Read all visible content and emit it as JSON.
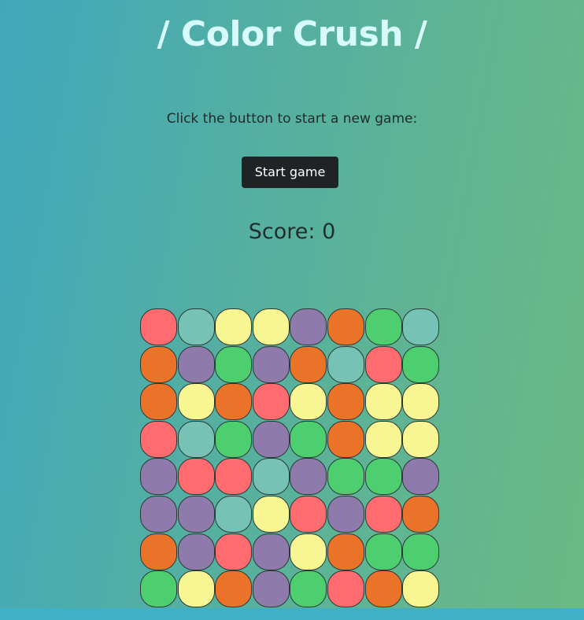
{
  "header": {
    "title": "/ Color Crush /"
  },
  "intro": {
    "prompt": "Click the button to start a new game:",
    "start_label": "Start game"
  },
  "score": {
    "label": "Score:",
    "value": "0"
  },
  "colors": {
    "red": "#ff6b6f",
    "teal": "#76c2b5",
    "yellow": "#f8f593",
    "purple": "#8e7aab",
    "orange": "#ea7229",
    "green": "#4dcf70"
  },
  "board": {
    "rows": 8,
    "cols": 8,
    "grid": [
      [
        "red",
        "teal",
        "yellow",
        "yellow",
        "purple",
        "orange",
        "green",
        "teal"
      ],
      [
        "orange",
        "purple",
        "green",
        "purple",
        "orange",
        "teal",
        "red",
        "green"
      ],
      [
        "orange",
        "yellow",
        "orange",
        "red",
        "yellow",
        "orange",
        "yellow",
        "yellow"
      ],
      [
        "red",
        "teal",
        "green",
        "purple",
        "green",
        "orange",
        "yellow",
        "yellow"
      ],
      [
        "purple",
        "red",
        "red",
        "teal",
        "purple",
        "green",
        "green",
        "purple"
      ],
      [
        "purple",
        "purple",
        "teal",
        "yellow",
        "red",
        "purple",
        "red",
        "orange"
      ],
      [
        "orange",
        "purple",
        "red",
        "purple",
        "yellow",
        "orange",
        "green",
        "green"
      ],
      [
        "green",
        "yellow",
        "orange",
        "purple",
        "green",
        "red",
        "orange",
        "yellow"
      ]
    ]
  }
}
